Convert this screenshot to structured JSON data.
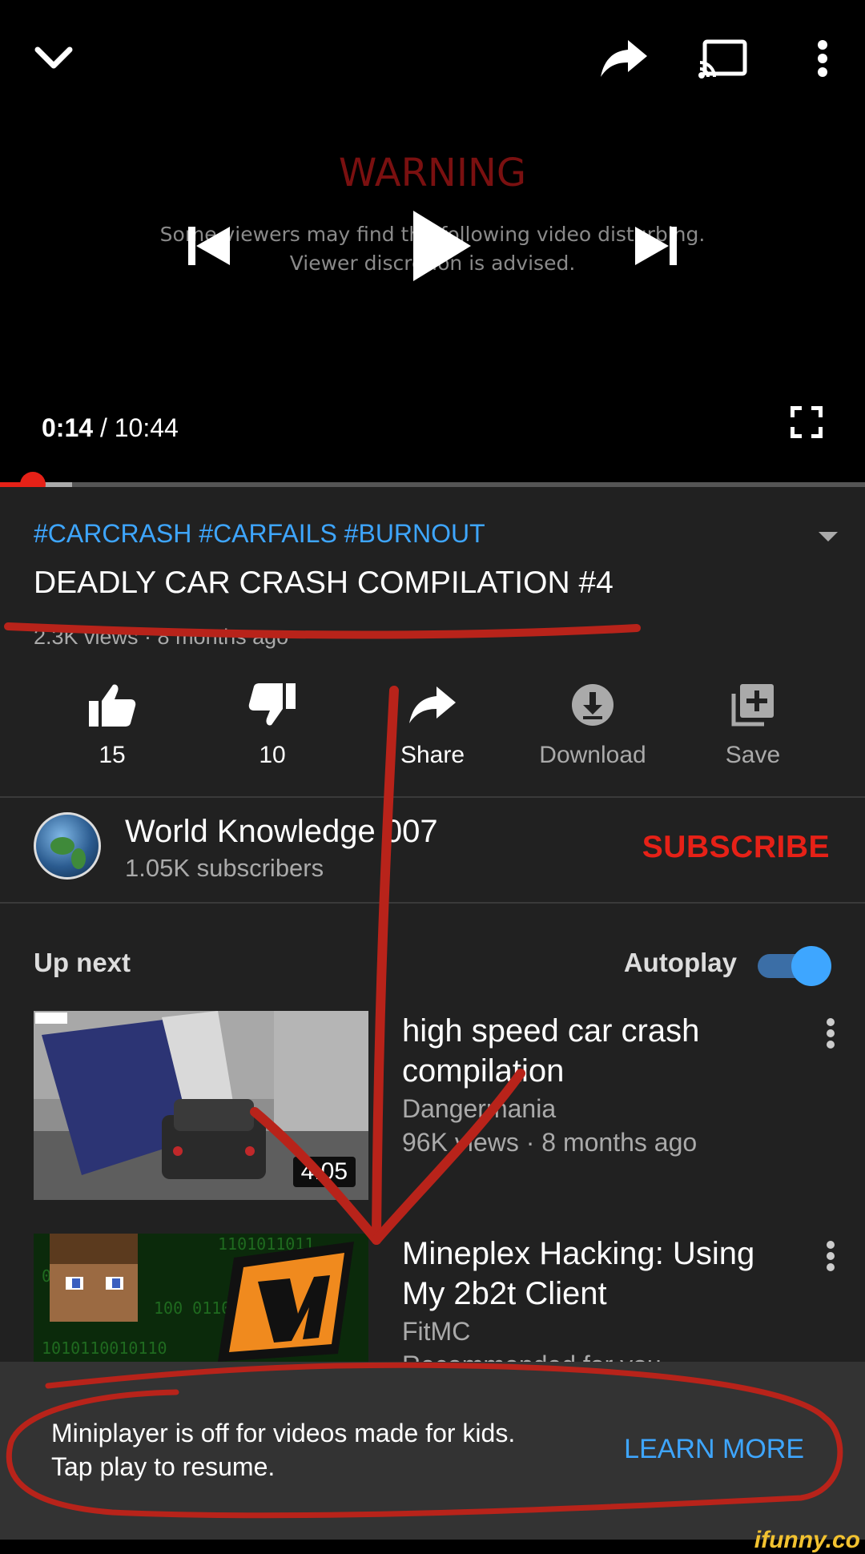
{
  "player": {
    "warning_title": "WARNING",
    "warning_line1": "Some viewers may find the following video disturbing.",
    "warning_line2": "Viewer discretion is advised.",
    "current_time": "0:14",
    "separator": "/",
    "duration": "10:44",
    "progress_played": 0.038,
    "progress_buffered": 0.083
  },
  "video": {
    "hashtags": "#CARCRASH #CARFAILS #BURNOUT",
    "title": "DEADLY CAR CRASH COMPILATION #4",
    "meta": "2.3K views · 8 months ago"
  },
  "actions": {
    "like_count": "15",
    "dislike_count": "10",
    "share_label": "Share",
    "download_label": "Download",
    "save_label": "Save"
  },
  "channel": {
    "name": "World Knowledge 007",
    "subscribers": "1.05K subscribers",
    "subscribe_label": "SUBSCRIBE"
  },
  "upnext": {
    "label": "Up next",
    "autoplay_label": "Autoplay",
    "autoplay_on": true
  },
  "videos": [
    {
      "title": "high speed car crash compilation",
      "channel": "Dangermania",
      "meta": "96K views · 8 months ago",
      "duration": "4:05"
    },
    {
      "title": "Mineplex Hacking: Using My 2b2t Client",
      "channel": "FitMC",
      "meta": "Recommended for you"
    }
  ],
  "snackbar": {
    "line1": "Miniplayer is off for videos made for kids.",
    "line2": "Tap play to resume.",
    "action_label": "LEARN MORE"
  },
  "watermark": "ifunny.co",
  "colors": {
    "accent_red": "#e62117",
    "link_blue": "#3ea6ff",
    "background": "#212121",
    "annotation_red": "#b8231a"
  }
}
